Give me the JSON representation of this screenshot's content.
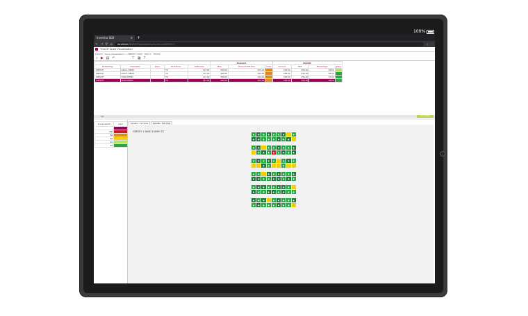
{
  "status": {
    "battery": "100%"
  },
  "browser": {
    "tab_title": "Inventia SEB",
    "tab_close": "✕",
    "new_tab": "+",
    "url_host": "localhost",
    "url_path": "/INVENTIA/Analytics/ScoreCard/ODU-1",
    "nav_back": "←",
    "nav_forward": "→",
    "nav_reload": "⟳",
    "nav_home": "⌂"
  },
  "app": {
    "title": "TOUCH Score Visualization",
    "breadcrumb": "TOUCH - Score Visualization > OBESITY 2025 - ODU-1 - TRUCK",
    "toolbar_icons": [
      "search-icon",
      "play-icon",
      "chart-icon",
      "undo-icon",
      "filter-icon",
      "export-icon",
      "help-icon"
    ]
  },
  "results_table": {
    "group_headers": {
      "scenario": "Scenario",
      "results": "Results"
    },
    "columns": [
      "ID Building",
      "Simulation",
      "Zone",
      "Risk Zone",
      "GAB Area",
      "Max",
      "Percent Diff (ms)",
      "Color",
      "Current",
      "Real",
      "Percentage",
      "Zone"
    ],
    "rows": [
      {
        "id": "OBESITY",
        "sim": "ODU-1 DEMO",
        "zone": "",
        "risk": "TZ",
        "gab": "313.00",
        "max": "384.00",
        "pct": "100.00",
        "c1": "#e08a1a",
        "cur": "322.00",
        "real": "356.00",
        "pct2": "66.00",
        "c2": "#b7e36c",
        "selected": false
      },
      {
        "id": "OBESITY",
        "sim": "ODU-1 DEMO",
        "zone": "",
        "risk": "TZ",
        "gab": "272.00",
        "max": "384.00",
        "pct": "100.00",
        "c1": "#e08a1a",
        "cur": "256.00",
        "real": "356.00",
        "pct2": "66.00",
        "c2": "#28a745",
        "selected": false
      },
      {
        "id": "OBESITY",
        "sim": "TURN DEMO",
        "zone": "",
        "risk": "TZ",
        "gab": "313.00",
        "max": "384.00",
        "pct": "100.00",
        "c1": "#e08a1a",
        "cur": "326.00",
        "real": "356.00",
        "pct2": "51.00",
        "c2": "#28a745",
        "selected": false
      },
      {
        "id": "OBESITY",
        "sim": "TURN DEMO",
        "zone": "",
        "risk": "TZ",
        "gab": "313.00",
        "max": "384.00",
        "pct": "100.00",
        "c1": "#e08a1a",
        "cur": "326.00",
        "real": "356.00",
        "pct2": "66.00",
        "c2": "#28a745",
        "selected": true
      }
    ]
  },
  "midbar": {
    "label": "KPI",
    "badge": "GO / NOGO"
  },
  "legend": {
    "headers": [
      "Score Level ID",
      "Color"
    ],
    "rows": [
      {
        "v": "",
        "c": "#a0005a"
      },
      {
        "v": "100",
        "c": "#c81e1e"
      },
      {
        "v": "80",
        "c": "#e08a1a"
      },
      {
        "v": "60",
        "c": "#f5d000"
      },
      {
        "v": "40",
        "c": "#b7e36c"
      },
      {
        "v": "20",
        "c": "#28a745"
      }
    ]
  },
  "lower_tabs": [
    "Results - Ex Fields",
    "Results - Tab View"
  ],
  "panel": {
    "title": "OBESITY 1 BASE 3 DEMO TZ"
  },
  "blocks": [
    [
      [
        "g",
        "d",
        "g",
        "d",
        "g",
        "g",
        "d",
        "y",
        "g"
      ],
      [
        "d",
        "d",
        "g",
        "g",
        "g",
        "d",
        "g",
        "d",
        "y"
      ]
    ],
    [
      [
        "g",
        "d",
        "y",
        "g",
        "g",
        "d",
        "g",
        "g",
        "d"
      ],
      [
        "y",
        "g",
        "d",
        "g",
        "r",
        "g",
        "d",
        "g",
        "d"
      ]
    ],
    [
      [
        "g",
        "d",
        "g",
        "d",
        "g",
        "y",
        "g",
        "d",
        "g"
      ],
      [
        "y",
        "y",
        "d",
        "g",
        "y",
        "y",
        "g",
        "y",
        "y"
      ]
    ],
    [
      [
        "g",
        "g",
        "y",
        "d",
        "g",
        "d",
        "g",
        "g",
        "d"
      ],
      [
        "d",
        "d",
        "g",
        "g",
        "d",
        "d",
        "g",
        "d",
        "g"
      ]
    ],
    [
      [
        "g",
        "d",
        "d",
        "g",
        "g",
        "d",
        "d",
        "g",
        "y"
      ],
      [
        "d",
        "g",
        "g",
        "d",
        "d",
        "g",
        "d",
        "g",
        "g"
      ]
    ],
    [
      [
        "d",
        "g",
        "d",
        "y",
        "g",
        "d",
        "g",
        "g",
        "d"
      ],
      [
        "g",
        "d",
        "g",
        "g",
        "g",
        "d",
        "g",
        "g",
        "y"
      ]
    ]
  ]
}
